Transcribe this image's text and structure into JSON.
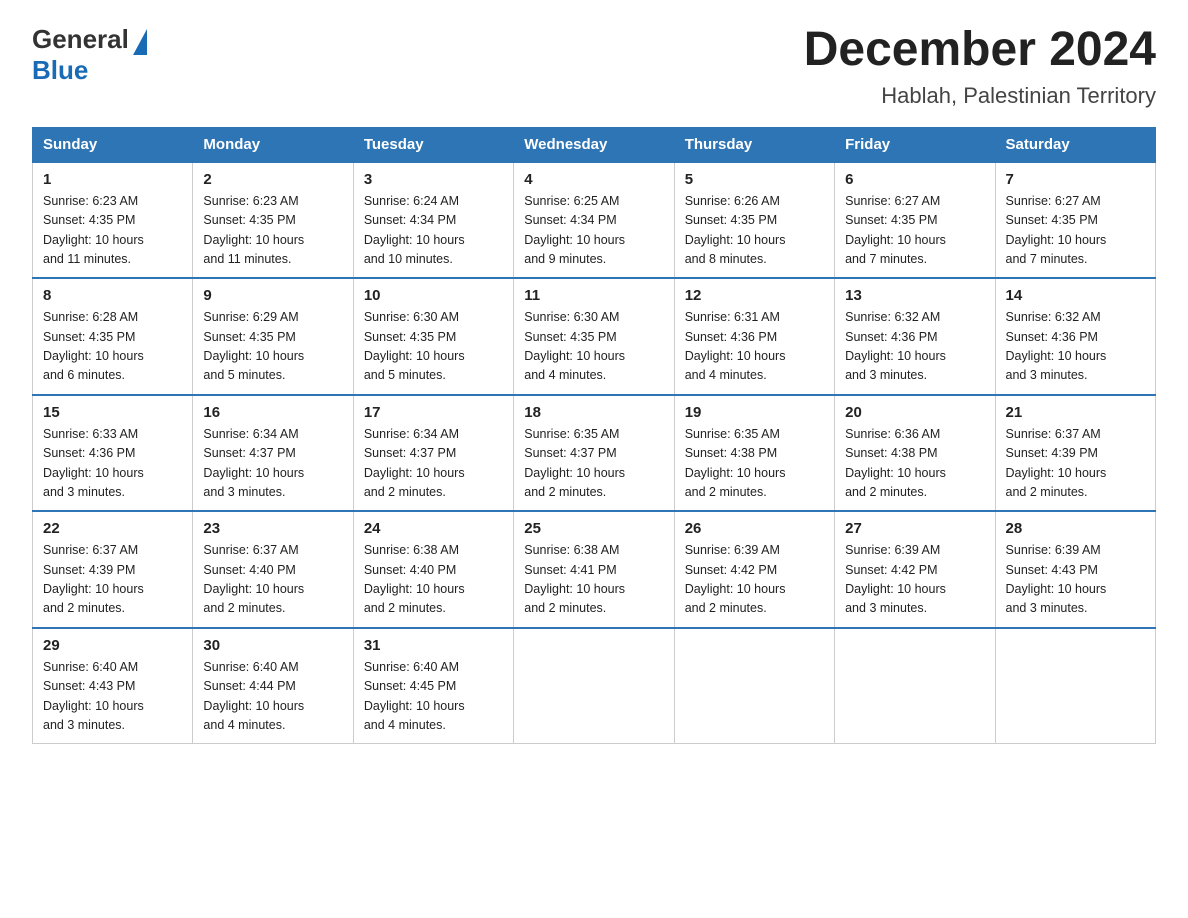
{
  "header": {
    "logo_general": "General",
    "logo_blue": "Blue",
    "month_title": "December 2024",
    "location": "Hablah, Palestinian Territory"
  },
  "weekdays": [
    "Sunday",
    "Monday",
    "Tuesday",
    "Wednesday",
    "Thursday",
    "Friday",
    "Saturday"
  ],
  "weeks": [
    [
      {
        "day": "1",
        "sunrise": "6:23 AM",
        "sunset": "4:35 PM",
        "daylight": "10 hours and 11 minutes."
      },
      {
        "day": "2",
        "sunrise": "6:23 AM",
        "sunset": "4:35 PM",
        "daylight": "10 hours and 11 minutes."
      },
      {
        "day": "3",
        "sunrise": "6:24 AM",
        "sunset": "4:34 PM",
        "daylight": "10 hours and 10 minutes."
      },
      {
        "day": "4",
        "sunrise": "6:25 AM",
        "sunset": "4:34 PM",
        "daylight": "10 hours and 9 minutes."
      },
      {
        "day": "5",
        "sunrise": "6:26 AM",
        "sunset": "4:35 PM",
        "daylight": "10 hours and 8 minutes."
      },
      {
        "day": "6",
        "sunrise": "6:27 AM",
        "sunset": "4:35 PM",
        "daylight": "10 hours and 7 minutes."
      },
      {
        "day": "7",
        "sunrise": "6:27 AM",
        "sunset": "4:35 PM",
        "daylight": "10 hours and 7 minutes."
      }
    ],
    [
      {
        "day": "8",
        "sunrise": "6:28 AM",
        "sunset": "4:35 PM",
        "daylight": "10 hours and 6 minutes."
      },
      {
        "day": "9",
        "sunrise": "6:29 AM",
        "sunset": "4:35 PM",
        "daylight": "10 hours and 5 minutes."
      },
      {
        "day": "10",
        "sunrise": "6:30 AM",
        "sunset": "4:35 PM",
        "daylight": "10 hours and 5 minutes."
      },
      {
        "day": "11",
        "sunrise": "6:30 AM",
        "sunset": "4:35 PM",
        "daylight": "10 hours and 4 minutes."
      },
      {
        "day": "12",
        "sunrise": "6:31 AM",
        "sunset": "4:36 PM",
        "daylight": "10 hours and 4 minutes."
      },
      {
        "day": "13",
        "sunrise": "6:32 AM",
        "sunset": "4:36 PM",
        "daylight": "10 hours and 3 minutes."
      },
      {
        "day": "14",
        "sunrise": "6:32 AM",
        "sunset": "4:36 PM",
        "daylight": "10 hours and 3 minutes."
      }
    ],
    [
      {
        "day": "15",
        "sunrise": "6:33 AM",
        "sunset": "4:36 PM",
        "daylight": "10 hours and 3 minutes."
      },
      {
        "day": "16",
        "sunrise": "6:34 AM",
        "sunset": "4:37 PM",
        "daylight": "10 hours and 3 minutes."
      },
      {
        "day": "17",
        "sunrise": "6:34 AM",
        "sunset": "4:37 PM",
        "daylight": "10 hours and 2 minutes."
      },
      {
        "day": "18",
        "sunrise": "6:35 AM",
        "sunset": "4:37 PM",
        "daylight": "10 hours and 2 minutes."
      },
      {
        "day": "19",
        "sunrise": "6:35 AM",
        "sunset": "4:38 PM",
        "daylight": "10 hours and 2 minutes."
      },
      {
        "day": "20",
        "sunrise": "6:36 AM",
        "sunset": "4:38 PM",
        "daylight": "10 hours and 2 minutes."
      },
      {
        "day": "21",
        "sunrise": "6:37 AM",
        "sunset": "4:39 PM",
        "daylight": "10 hours and 2 minutes."
      }
    ],
    [
      {
        "day": "22",
        "sunrise": "6:37 AM",
        "sunset": "4:39 PM",
        "daylight": "10 hours and 2 minutes."
      },
      {
        "day": "23",
        "sunrise": "6:37 AM",
        "sunset": "4:40 PM",
        "daylight": "10 hours and 2 minutes."
      },
      {
        "day": "24",
        "sunrise": "6:38 AM",
        "sunset": "4:40 PM",
        "daylight": "10 hours and 2 minutes."
      },
      {
        "day": "25",
        "sunrise": "6:38 AM",
        "sunset": "4:41 PM",
        "daylight": "10 hours and 2 minutes."
      },
      {
        "day": "26",
        "sunrise": "6:39 AM",
        "sunset": "4:42 PM",
        "daylight": "10 hours and 2 minutes."
      },
      {
        "day": "27",
        "sunrise": "6:39 AM",
        "sunset": "4:42 PM",
        "daylight": "10 hours and 3 minutes."
      },
      {
        "day": "28",
        "sunrise": "6:39 AM",
        "sunset": "4:43 PM",
        "daylight": "10 hours and 3 minutes."
      }
    ],
    [
      {
        "day": "29",
        "sunrise": "6:40 AM",
        "sunset": "4:43 PM",
        "daylight": "10 hours and 3 minutes."
      },
      {
        "day": "30",
        "sunrise": "6:40 AM",
        "sunset": "4:44 PM",
        "daylight": "10 hours and 4 minutes."
      },
      {
        "day": "31",
        "sunrise": "6:40 AM",
        "sunset": "4:45 PM",
        "daylight": "10 hours and 4 minutes."
      },
      null,
      null,
      null,
      null
    ]
  ],
  "labels": {
    "sunrise": "Sunrise:",
    "sunset": "Sunset:",
    "daylight": "Daylight:"
  }
}
